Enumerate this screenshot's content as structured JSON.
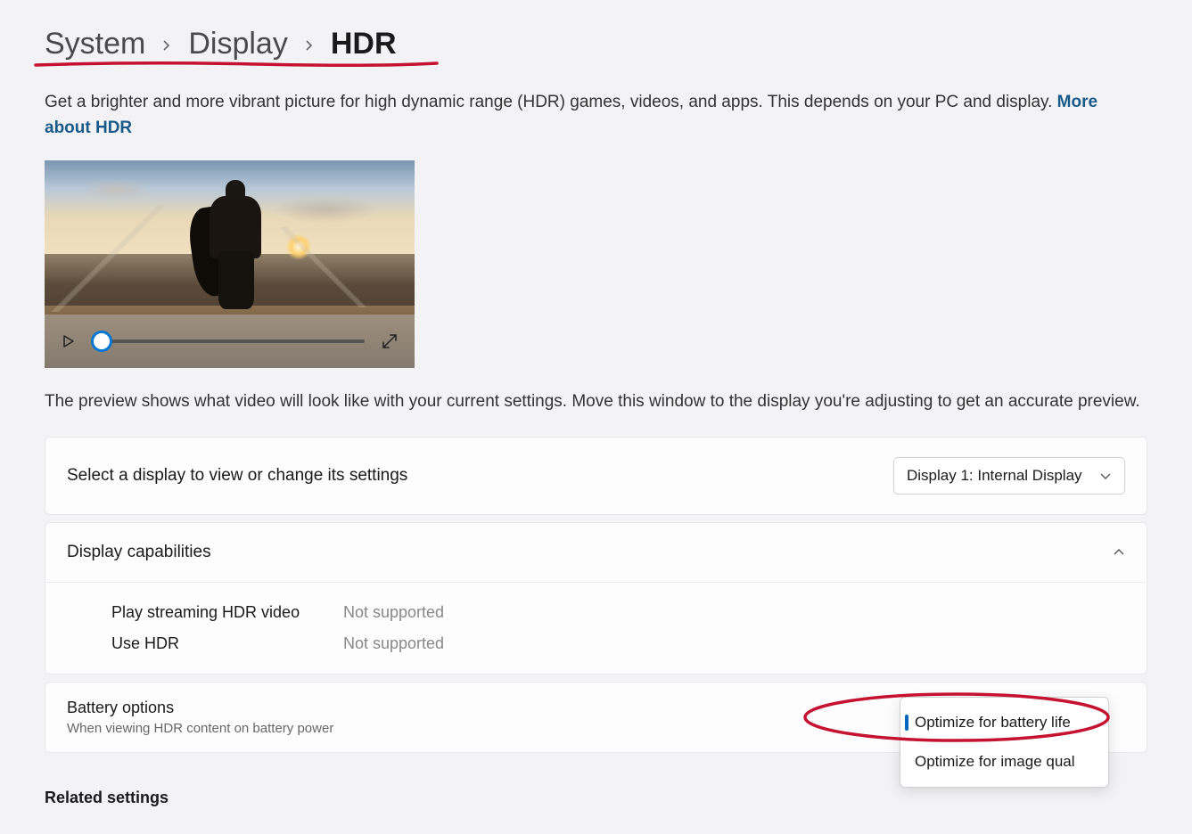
{
  "breadcrumb": {
    "items": [
      "System",
      "Display",
      "HDR"
    ]
  },
  "description": {
    "text": "Get a brighter and more vibrant picture for high dynamic range (HDR) games, videos, and apps. This depends on your PC and display. ",
    "link_text": "More about HDR"
  },
  "preview_description": "The preview shows what video will look like with your current settings. Move this window to the display you're adjusting to get an accurate preview.",
  "display_selector": {
    "label": "Select a display to view or change its settings",
    "selected": "Display 1: Internal Display"
  },
  "capabilities": {
    "label": "Display capabilities",
    "rows": [
      {
        "label": "Play streaming HDR video",
        "value": "Not supported"
      },
      {
        "label": "Use HDR",
        "value": "Not supported"
      }
    ]
  },
  "battery": {
    "title": "Battery options",
    "subtitle": "When viewing HDR content on battery power",
    "options": [
      "Optimize for battery life",
      "Optimize for image qual"
    ],
    "selected_index": 0
  },
  "related_heading": "Related settings",
  "annotation": {
    "underline_color": "#c41230",
    "ellipse_color": "#c41230"
  }
}
